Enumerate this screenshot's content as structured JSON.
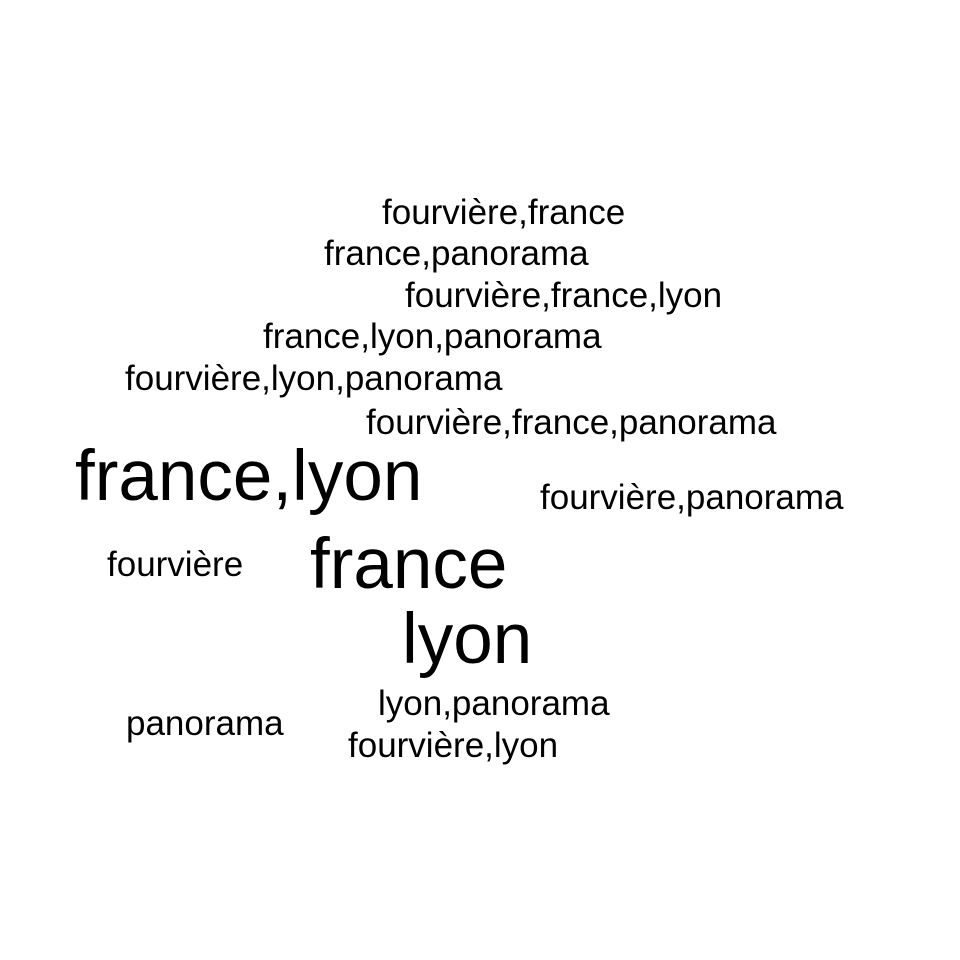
{
  "words": [
    "fourvière,france",
    "france,panorama",
    "fourvière,france,lyon",
    "france,lyon,panorama",
    "fourvière,lyon,panorama",
    "fourvière,france,panorama",
    "france,lyon",
    "fourvière,panorama",
    "fourvière",
    "france",
    "lyon",
    "lyon,panorama",
    "panorama",
    "fourvière,lyon"
  ],
  "colors": {
    "background": "#ffffff",
    "text": "#000000"
  }
}
